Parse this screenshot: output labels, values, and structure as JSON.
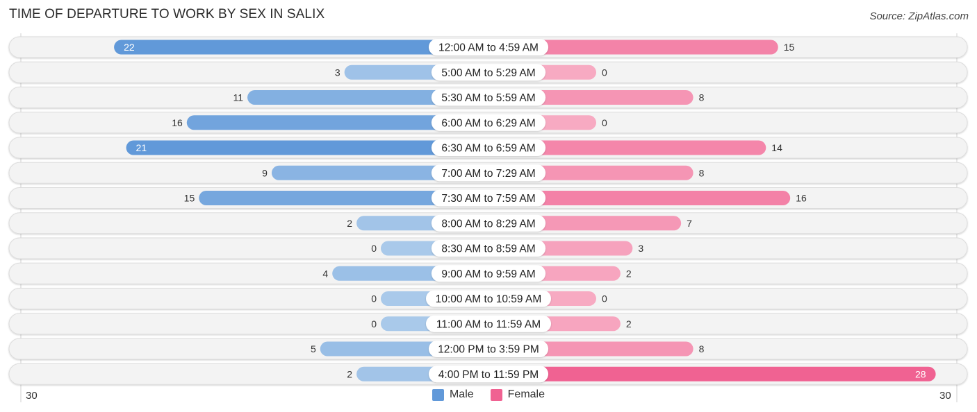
{
  "title": "TIME OF DEPARTURE TO WORK BY SEX IN SALIX",
  "source": "Source: ZipAtlas.com",
  "colors": {
    "male_strong": "#6199d9",
    "male_light": "#a9c9ea",
    "female_strong": "#f06292",
    "female_light": "#f7aac2",
    "row_bg": "#f3f3f3",
    "row_border": "#dcdcdc"
  },
  "legend": [
    {
      "label": "Male",
      "color": "#6199d9"
    },
    {
      "label": "Female",
      "color": "#f06292"
    }
  ],
  "axis": {
    "left_label": "30",
    "right_label": "30"
  },
  "chart_data": {
    "type": "bar",
    "orientation": "horizontal-butterfly",
    "title": "TIME OF DEPARTURE TO WORK BY SEX IN SALIX",
    "xlabel": "",
    "ylabel": "",
    "xlim": [
      -30,
      30
    ],
    "legend_position": "bottom",
    "categories": [
      "12:00 AM to 4:59 AM",
      "5:00 AM to 5:29 AM",
      "5:30 AM to 5:59 AM",
      "6:00 AM to 6:29 AM",
      "6:30 AM to 6:59 AM",
      "7:00 AM to 7:29 AM",
      "7:30 AM to 7:59 AM",
      "8:00 AM to 8:29 AM",
      "8:30 AM to 8:59 AM",
      "9:00 AM to 9:59 AM",
      "10:00 AM to 10:59 AM",
      "11:00 AM to 11:59 AM",
      "12:00 PM to 3:59 PM",
      "4:00 PM to 11:59 PM"
    ],
    "series": [
      {
        "name": "Male",
        "values": [
          22,
          3,
          11,
          16,
          21,
          9,
          15,
          2,
          0,
          4,
          0,
          0,
          5,
          2
        ]
      },
      {
        "name": "Female",
        "values": [
          15,
          0,
          8,
          0,
          14,
          8,
          16,
          7,
          3,
          2,
          0,
          2,
          8,
          28
        ]
      }
    ]
  }
}
